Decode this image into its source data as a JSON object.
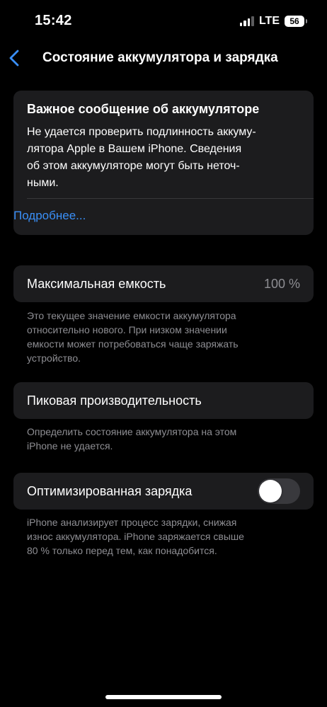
{
  "status_bar": {
    "time": "15:42",
    "network": "LTE",
    "battery_level": "56",
    "signal_bars_active": 3,
    "signal_bars_total": 4
  },
  "nav": {
    "back_icon": "chevron-left-icon",
    "title": "Состояние аккумулятора и зарядка",
    "accent_color": "#3a8ff7"
  },
  "alert": {
    "title": "Важное сообщение об аккумуляторе",
    "body_lines": [
      "Не удается проверить подлинность аккуму-",
      "лятора Apple в Вашем iPhone. Сведения",
      "об этом аккумуляторе могут быть неточ-",
      "ными."
    ],
    "link": "Подробнее..."
  },
  "capacity": {
    "label": "Максимальная емкость",
    "value": "100 %",
    "footnote_lines": [
      "Это текущее значение емкости аккумулятора",
      "относительно нового. При низком значении",
      "емкости может потребоваться чаще заряжать",
      "устройство."
    ]
  },
  "peak": {
    "label": "Пиковая производительность",
    "footnote_lines": [
      "Определить состояние аккумулятора на этом",
      "iPhone не удается."
    ]
  },
  "optimized_charging": {
    "label": "Оптимизированная зарядка",
    "enabled": false,
    "footnote_lines": [
      "iPhone анализирует процесс зарядки, снижая",
      "износ аккумулятора. iPhone заряжается свыше",
      "80 % только перед тем, как понадобится."
    ]
  },
  "colors": {
    "background": "#000000",
    "card": "#1c1c1e",
    "secondary_text": "#8e8e93",
    "link": "#3a8ff7",
    "toggle_off": "#39393d"
  }
}
